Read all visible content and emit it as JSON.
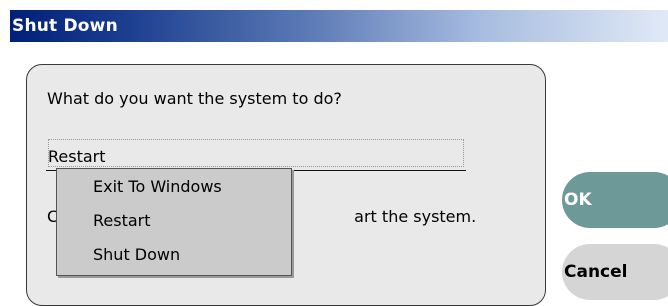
{
  "window": {
    "title": "Shut Down"
  },
  "dialog": {
    "question": "What do you want the system to do?",
    "selected": "Restart",
    "description_prefix": "C",
    "description_suffix": "art the system."
  },
  "dropdown": {
    "options": [
      "Exit To Windows",
      "Restart",
      "Shut Down"
    ]
  },
  "buttons": {
    "ok": "OK",
    "cancel": "Cancel"
  },
  "colors": {
    "title_bar_start": "#00207a",
    "ok_button": "#6d9a98",
    "cancel_button": "#d5d5d5"
  }
}
